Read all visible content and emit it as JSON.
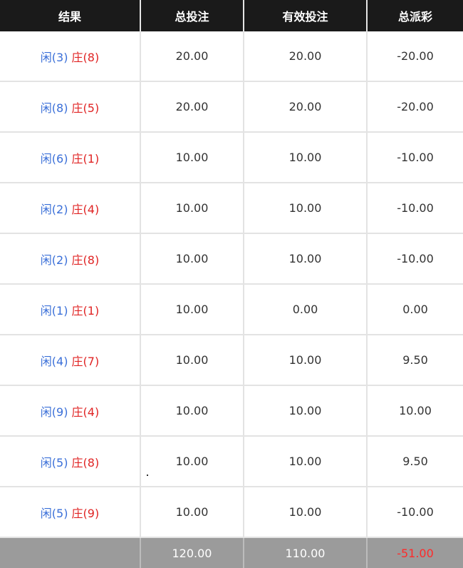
{
  "header": {
    "result": "结果",
    "total_bet": "总投注",
    "valid_bet": "有效投注",
    "total_payout": "总派彩"
  },
  "rows": [
    {
      "player": "闲(3)",
      "banker": "庄(8)",
      "total_bet": "20.00",
      "valid_bet": "20.00",
      "payout": "-20.00",
      "payout_sign": "neg"
    },
    {
      "player": "闲(8)",
      "banker": "庄(5)",
      "total_bet": "20.00",
      "valid_bet": "20.00",
      "payout": "-20.00",
      "payout_sign": "neg"
    },
    {
      "player": "闲(6)",
      "banker": "庄(1)",
      "total_bet": "10.00",
      "valid_bet": "10.00",
      "payout": "-10.00",
      "payout_sign": "neg"
    },
    {
      "player": "闲(2)",
      "banker": "庄(4)",
      "total_bet": "10.00",
      "valid_bet": "10.00",
      "payout": "-10.00",
      "payout_sign": "neg"
    },
    {
      "player": "闲(2)",
      "banker": "庄(8)",
      "total_bet": "10.00",
      "valid_bet": "10.00",
      "payout": "-10.00",
      "payout_sign": "neg"
    },
    {
      "player": "闲(1)",
      "banker": "庄(1)",
      "total_bet": "10.00",
      "valid_bet": "0.00",
      "payout": "0.00",
      "payout_sign": "zero"
    },
    {
      "player": "闲(4)",
      "banker": "庄(7)",
      "total_bet": "10.00",
      "valid_bet": "10.00",
      "payout": "9.50",
      "payout_sign": "pos"
    },
    {
      "player": "闲(9)",
      "banker": "庄(4)",
      "total_bet": "10.00",
      "valid_bet": "10.00",
      "payout": "10.00",
      "payout_sign": "pos"
    },
    {
      "player": "闲(5)",
      "banker": "庄(8)",
      "total_bet": "10.00",
      "valid_bet": "10.00",
      "payout": "9.50",
      "payout_sign": "pos"
    },
    {
      "player": "闲(5)",
      "banker": "庄(9)",
      "total_bet": "10.00",
      "valid_bet": "10.00",
      "payout": "-10.00",
      "payout_sign": "neg"
    }
  ],
  "totals": {
    "total_bet": "120.00",
    "valid_bet": "110.00",
    "payout": "-51.00"
  },
  "colors": {
    "header_bg": "#1a1a1a",
    "player": "#3a6fd8",
    "banker": "#e02424",
    "negative": "#ff2a2a",
    "total_row_bg": "#9b9b9b"
  }
}
